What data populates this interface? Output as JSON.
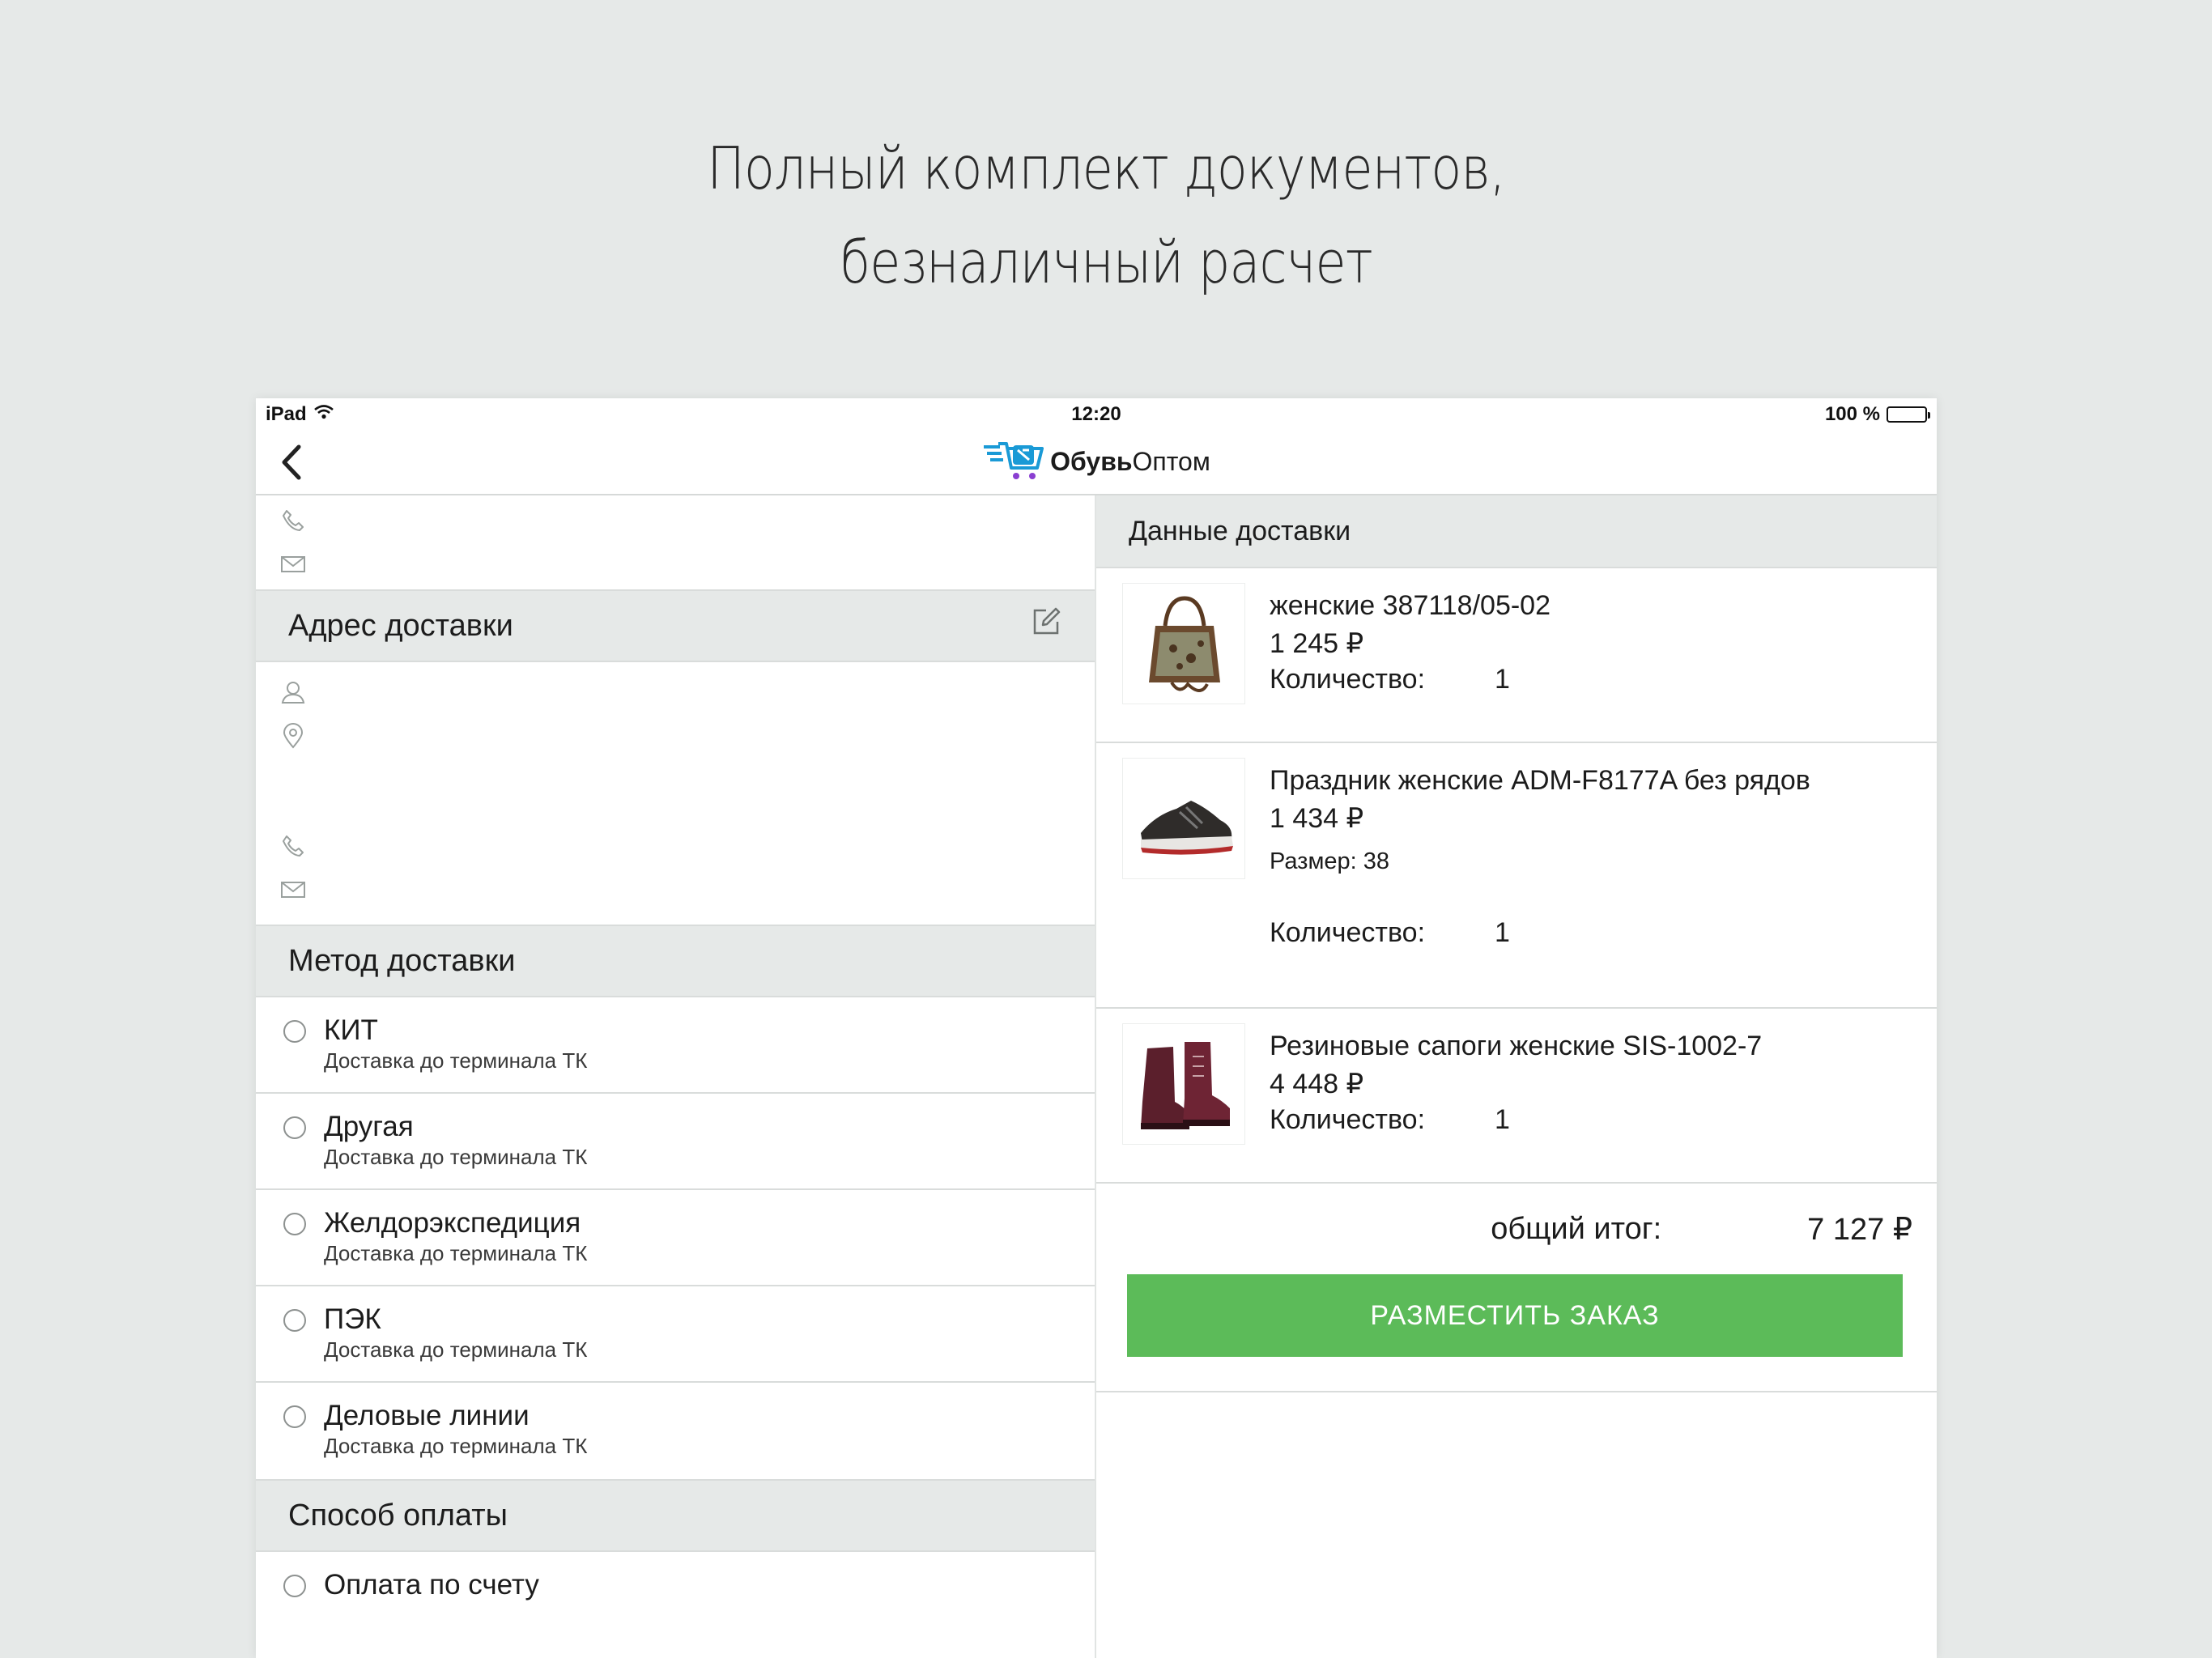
{
  "promo": {
    "line1": "Полный комплект документов,",
    "line2": "безналичный расчет"
  },
  "status_bar": {
    "device": "iPad",
    "time": "12:20",
    "battery": "100 %"
  },
  "navbar": {
    "logo_bold": "Обувь",
    "logo_regular": "Оптом"
  },
  "left": {
    "address_header": "Адрес доставки",
    "delivery_method_header": "Метод доставки",
    "delivery_options": [
      {
        "title": "КИТ",
        "sub": "Доставка до терминала ТК"
      },
      {
        "title": "Другая",
        "sub": "Доставка до терминала ТК"
      },
      {
        "title": "Желдорэкспедиция",
        "sub": "Доставка до терминала ТК"
      },
      {
        "title": "ПЭК",
        "sub": "Доставка до терминала ТК"
      },
      {
        "title": "Деловые линии",
        "sub": "Доставка до терминала ТК"
      }
    ],
    "payment_header": "Способ оплаты",
    "payment_options": [
      {
        "title": "Оплата по счету"
      }
    ]
  },
  "right": {
    "header": "Данные доставки",
    "qty_label": "Количество:",
    "products": [
      {
        "name": "женские 387118/05-02",
        "price": "1 245 ₽",
        "qty": "1"
      },
      {
        "name": "Праздник женские ADM-F8177A без рядов",
        "price": "1 434 ₽",
        "size_label": "Размер:",
        "size": "38",
        "qty": "1"
      },
      {
        "name": "Резиновые сапоги женские SIS-1002-7",
        "price": "4 448 ₽",
        "qty": "1"
      }
    ],
    "total_label": "общий итог:",
    "total_value": "7 127 ₽",
    "order_button": "РАЗМЕСТИТЬ ЗАКАЗ"
  },
  "colors": {
    "accent_green": "#5cbb59",
    "section_gray": "#e6e9e8",
    "logo_blue": "#1a9ad6",
    "logo_purple": "#8a3fd1"
  }
}
